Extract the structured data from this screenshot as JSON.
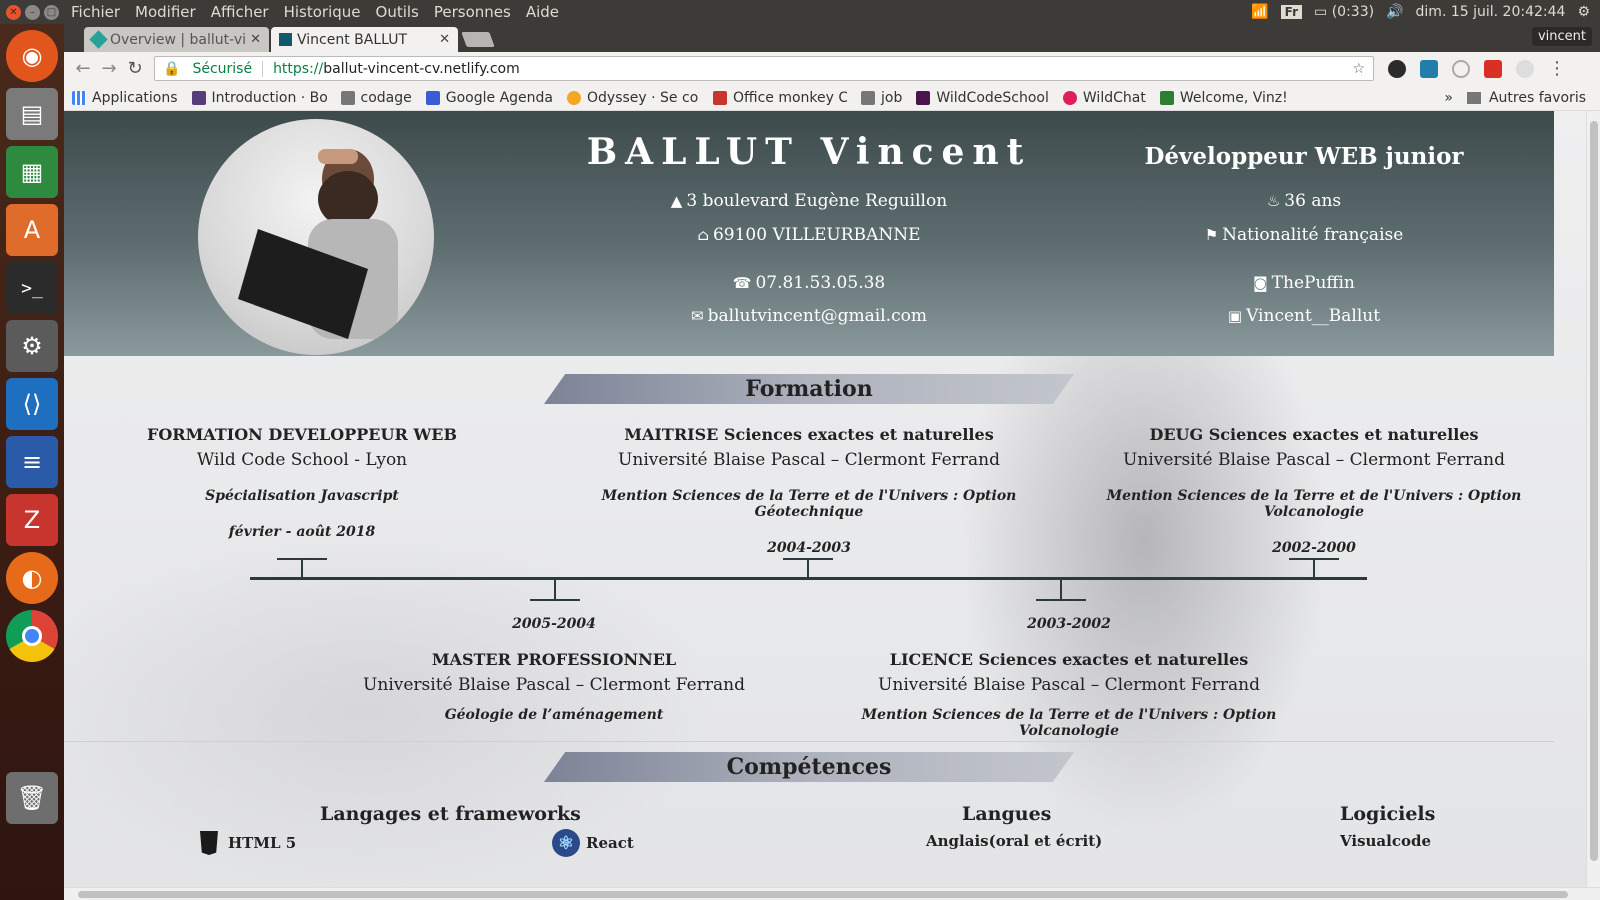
{
  "menubar": {
    "items": [
      "Fichier",
      "Modifier",
      "Afficher",
      "Historique",
      "Outils",
      "Personnes",
      "Aide"
    ],
    "keyboard_layout": "Fr",
    "battery": "(0:33)",
    "clock": "dim. 15 juil. 20:42:44"
  },
  "launcher": {
    "items": [
      "ubuntu-logo-icon",
      "files-icon",
      "spreadsheet-icon",
      "software-store-icon",
      "terminal-icon",
      "settings-icon",
      "vscode-icon",
      "document-icon",
      "zotero-icon",
      "firefox-icon",
      "chrome-icon",
      "trash-icon"
    ]
  },
  "tabs": [
    {
      "label": "Overview | ballut-vi",
      "active": false
    },
    {
      "label": "Vincent BALLUT",
      "active": true
    }
  ],
  "profile_name": "vincent",
  "omnibox": {
    "secure_label": "Sécurisé",
    "url_scheme": "https://",
    "url_rest": "ballut-vincent-cv.netlify.com"
  },
  "bookmarks": {
    "items": [
      "Applications",
      "Introduction · Bo",
      "codage",
      "Google Agenda",
      "Odyssey · Se con",
      "Office monkey C",
      "job",
      "WildCodeSchool",
      "WildChat",
      "Welcome, Vinz!"
    ],
    "overflow": "»",
    "other": "Autres favoris"
  },
  "cv": {
    "name": "BALLUT Vincent",
    "job_title": "Développeur WEB junior",
    "address1": "3 boulevard Eugène Reguillon",
    "address2": "69100 VILLEURBANNE",
    "phone": "07.81.53.05.38",
    "email": "ballutvincent@gmail.com",
    "age": "36 ans",
    "nationality": "Nationalité française",
    "github": "ThePuffin",
    "twitter": "Vincent__Ballut"
  },
  "formation": {
    "heading": "Formation",
    "top": [
      {
        "title": "FORMATION DEVELOPPEUR WEB",
        "school": "Wild Code School - Lyon",
        "desc": "Spécialisation Javascript",
        "date": "février - août 2018"
      },
      {
        "title": "MAITRISE Sciences exactes et naturelles",
        "school": "Université Blaise Pascal – Clermont Ferrand",
        "desc": "Mention Sciences de la Terre et de l'Univers : Option Géotechnique",
        "date": "2004-2003"
      },
      {
        "title": "DEUG Sciences exactes et naturelles",
        "school": "Université Blaise Pascal – Clermont Ferrand",
        "desc": "Mention Sciences de la Terre et de l'Univers : Option Volcanologie",
        "date": "2002-2000"
      }
    ],
    "bottom": [
      {
        "date": "2005-2004",
        "title": "MASTER PROFESSIONNEL",
        "school": "Université Blaise Pascal – Clermont Ferrand",
        "desc": "Géologie de l’aménagement"
      },
      {
        "date": "2003-2002",
        "title": "LICENCE Sciences exactes et naturelles",
        "school": "Université Blaise Pascal – Clermont Ferrand",
        "desc": "Mention Sciences de la Terre et de l'Univers : Option Volcanologie"
      }
    ]
  },
  "competences": {
    "heading": "Compétences",
    "languages_frameworks": {
      "heading": "Langages et frameworks",
      "items": [
        "HTML 5",
        "React"
      ]
    },
    "langues": {
      "heading": "Langues",
      "items": [
        "Anglais(oral et écrit)"
      ]
    },
    "logiciels": {
      "heading": "Logiciels",
      "items": [
        "Visualcode"
      ]
    }
  }
}
